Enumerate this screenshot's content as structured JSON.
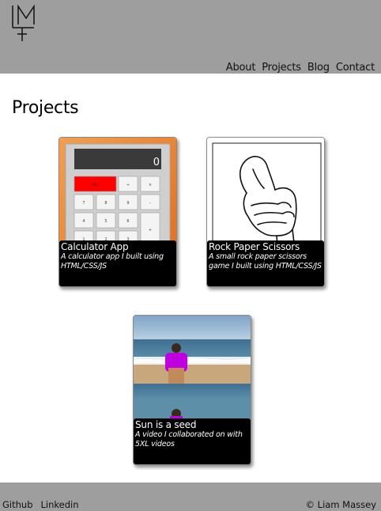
{
  "header": {
    "logo_icon": "lm-monogram-logo",
    "nav": [
      {
        "label": "About"
      },
      {
        "label": "Projects"
      },
      {
        "label": "Blog"
      },
      {
        "label": "Contact"
      }
    ]
  },
  "main": {
    "title": "Projects",
    "projects": [
      {
        "title": "Calculator App",
        "description": "A calculator app I built using HTML/CSS/JS",
        "image": "calculator-screenshot",
        "display": "0"
      },
      {
        "title": "Rock Paper Scissors",
        "description": "A small rock paper scissors game I built using HTML/CSS/JS",
        "image": "fist-drawing"
      },
      {
        "title": "Sun is a seed",
        "description": "A video I collaborated on with 5XL videos",
        "image": "beach-video-still"
      }
    ]
  },
  "footer": {
    "links": [
      {
        "label": "Github"
      },
      {
        "label": "Linkedin"
      }
    ],
    "copyright": "© Liam Massey"
  },
  "colors": {
    "header_bg": "#9e9e9e",
    "footer_bg": "#9e9e9e",
    "caption_bg": "#000000",
    "calc_orange": "#e8822c",
    "calc_clear": "#ff0000"
  }
}
